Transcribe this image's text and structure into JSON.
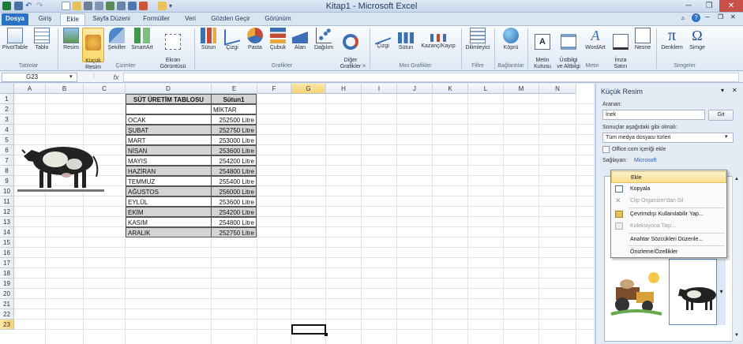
{
  "window": {
    "title": "Kitap1 - Microsoft Excel"
  },
  "tabs": [
    {
      "label": "Dosya"
    },
    {
      "label": "Giriş"
    },
    {
      "label": "Ekle"
    },
    {
      "label": "Sayfa Düzeni"
    },
    {
      "label": "Formüller"
    },
    {
      "label": "Veri"
    },
    {
      "label": "Gözden Geçir"
    },
    {
      "label": "Görünüm"
    }
  ],
  "ribbon": {
    "buttons": [
      {
        "label": "PivotTable",
        "icon": "pivottable-icon"
      },
      {
        "label": "Tablo",
        "icon": "table-icon"
      },
      {
        "label": "Resim",
        "icon": "picture-icon"
      },
      {
        "label": "Küçük\nResim",
        "icon": "clipart-icon"
      },
      {
        "label": "Şekiller",
        "icon": "shapes-icon"
      },
      {
        "label": "SmartArt",
        "icon": "smartart-icon"
      },
      {
        "label": "Ekran\nGörüntüsü",
        "icon": "screenshot-icon"
      },
      {
        "label": "Sütun",
        "icon": "column-chart-icon"
      },
      {
        "label": "Çizgi",
        "icon": "line-chart-icon"
      },
      {
        "label": "Pasta",
        "icon": "pie-chart-icon"
      },
      {
        "label": "Çubuk",
        "icon": "bar-chart-icon"
      },
      {
        "label": "Alan",
        "icon": "area-chart-icon"
      },
      {
        "label": "Dağılım",
        "icon": "scatter-chart-icon"
      },
      {
        "label": "Diğer\nGrafikler",
        "icon": "other-charts-icon"
      },
      {
        "label": "Çizgi",
        "icon": "sparkline-line-icon"
      },
      {
        "label": "Sütun",
        "icon": "sparkline-column-icon"
      },
      {
        "label": "Kazanç/Kayıp",
        "icon": "win-loss-icon"
      },
      {
        "label": "Dilimleyici",
        "icon": "slicer-icon"
      },
      {
        "label": "Köprü",
        "icon": "hyperlink-icon"
      },
      {
        "label": "Metin\nKutusu",
        "icon": "textbox-icon"
      },
      {
        "label": "Üstbilgi\nve Altbilgi",
        "icon": "header-footer-icon"
      },
      {
        "label": "WordArt",
        "icon": "wordart-icon"
      },
      {
        "label": "İmza\nSatırı",
        "icon": "signature-icon"
      },
      {
        "label": "Nesne",
        "icon": "object-icon"
      },
      {
        "label": "Denklem",
        "icon": "equation-icon"
      },
      {
        "label": "Simge",
        "icon": "symbol-icon"
      }
    ],
    "groups": [
      {
        "label": "Tablolar"
      },
      {
        "label": "Çizimler"
      },
      {
        "label": "Grafikler"
      },
      {
        "label": "Mini Grafikler"
      },
      {
        "label": "Filtre"
      },
      {
        "label": "Bağlantılar"
      },
      {
        "label": "Metin"
      },
      {
        "label": "Simgeler"
      }
    ]
  },
  "formula_bar": {
    "name_box": "G23",
    "fx": "fx",
    "value": ""
  },
  "grid": {
    "columns": [
      "A",
      "B",
      "C",
      "D",
      "E",
      "F",
      "G",
      "H",
      "I",
      "J",
      "K",
      "L",
      "M",
      "N"
    ],
    "rows": [
      "1",
      "2",
      "3",
      "4",
      "5",
      "6",
      "7",
      "8",
      "9",
      "10",
      "11",
      "12",
      "13",
      "14",
      "15",
      "16",
      "17",
      "18",
      "19",
      "20",
      "21",
      "22",
      "23"
    ],
    "selected_cell": "G23"
  },
  "table": {
    "title": "SÜT ÜRETİM TABLOSU",
    "column_header": "Sütun1",
    "subheader": "MİKTAR",
    "rows": [
      {
        "month": "OCAK",
        "amount": "252500 Litre"
      },
      {
        "month": "ŞUBAT",
        "amount": "252750 Litre"
      },
      {
        "month": "MART",
        "amount": "253000 Litre"
      },
      {
        "month": "NİSAN",
        "amount": "253600 Litre"
      },
      {
        "month": "MAYIS",
        "amount": "254200 Litre"
      },
      {
        "month": "HAZİRAN",
        "amount": "254800 Litre"
      },
      {
        "month": "TEMMUZ",
        "amount": "255400 Litre"
      },
      {
        "month": "AĞUSTOS",
        "amount": "256000 Litre"
      },
      {
        "month": "EYLÜL",
        "amount": "253600 Litre"
      },
      {
        "month": "EKİM",
        "amount": "254200 Litre"
      },
      {
        "month": "KASIM",
        "amount": "254800 Litre"
      },
      {
        "month": "ARALIK",
        "amount": "252750 Litre"
      }
    ]
  },
  "task_pane": {
    "title": "Küçük Resim",
    "search_label": "Aranan:",
    "search_value": "İnek",
    "go_button": "Git",
    "results_label": "Sonuçlar aşağıdaki gibi olmalı:",
    "media_type": "Tüm medya dosyası türleri",
    "office_checkbox": "Office.com içeriği ekle",
    "provider_label": "Sağlayan:",
    "provider_value": "Microsoft"
  },
  "context_menu": {
    "items": [
      {
        "label": "Ekle",
        "icon": "insert-icon",
        "state": "highlighted"
      },
      {
        "label": "Kopyala",
        "icon": "copy-icon",
        "state": "enabled"
      },
      {
        "label": "Clip Organizer'dan Sil",
        "icon": "delete-icon",
        "state": "disabled"
      },
      {
        "label": "Çevrimdışı Kullanılabilir Yap...",
        "icon": "offline-icon",
        "state": "enabled"
      },
      {
        "label": "Koleksiyona Taşı...",
        "icon": "move-icon",
        "state": "disabled"
      },
      {
        "label": "Anahtar Sözcükleri Düzenle...",
        "icon": "",
        "state": "enabled"
      },
      {
        "label": "Önizleme/Özellikler",
        "icon": "",
        "state": "enabled"
      }
    ]
  },
  "colors": {
    "file_tab": "#2a73c4",
    "highlight": "#fbd86a",
    "table_shade": "#d4d4d4"
  }
}
